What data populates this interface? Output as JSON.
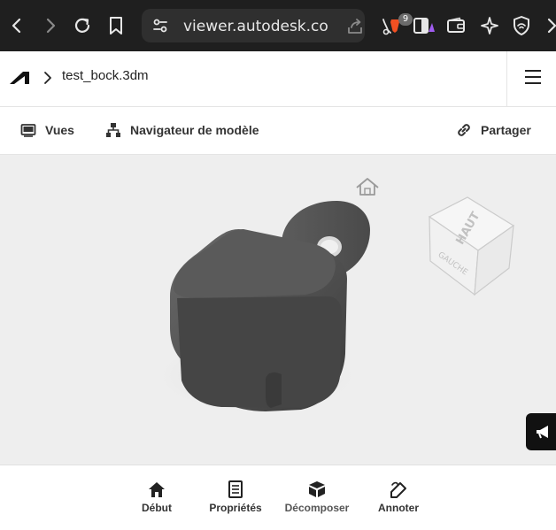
{
  "browser": {
    "url": "viewer.autodesk.co...",
    "extension_badge": "9"
  },
  "header": {
    "file_name": "test_bock.3dm"
  },
  "toolbar": {
    "views_label": "Vues",
    "model_browser_label": "Navigateur de modèle",
    "share_label": "Partager"
  },
  "viewcube": {
    "top_label": "HAUT",
    "left_label": "GAUCHE"
  },
  "bottom_nav": {
    "items": [
      {
        "label": "Début",
        "icon": "home-icon"
      },
      {
        "label": "Propriétés",
        "icon": "properties-icon"
      },
      {
        "label": "Décomposer",
        "icon": "explode-icon"
      },
      {
        "label": "Annoter",
        "icon": "annotate-icon"
      }
    ]
  },
  "colors": {
    "browser_chrome": "#1f1f1f",
    "viewport_bg": "#eeeeee",
    "model": "#4a4a4a"
  }
}
